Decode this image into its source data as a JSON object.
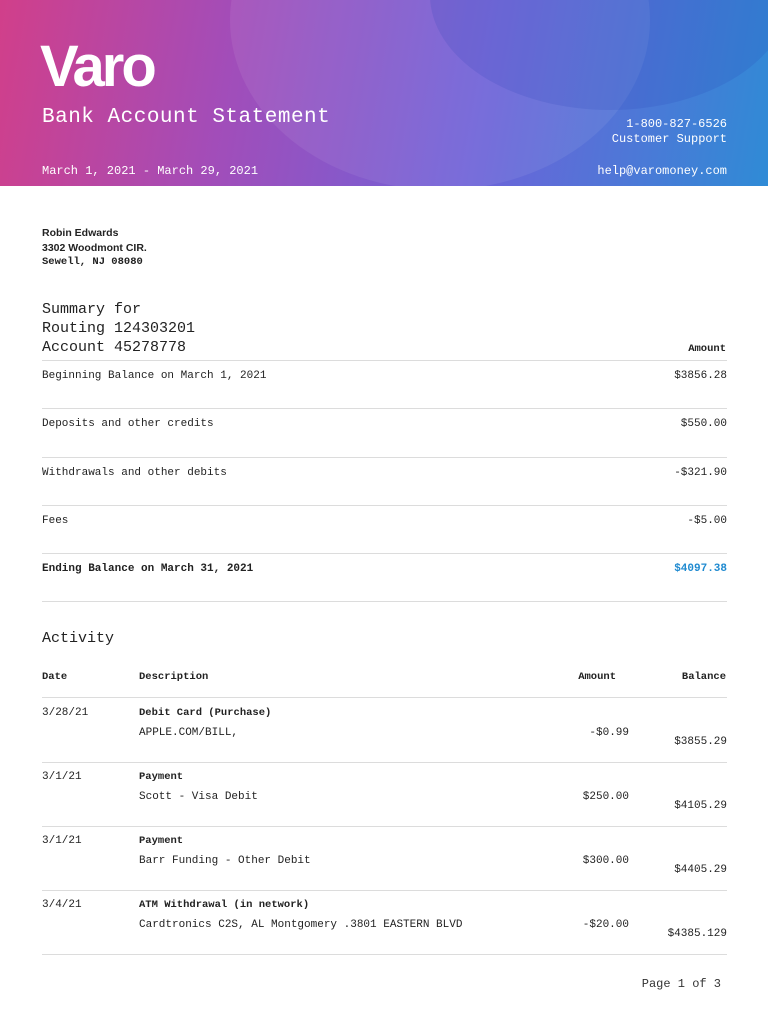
{
  "header": {
    "logo": "Varo",
    "title": "Bank Account Statement",
    "period": "March 1, 2021 - March 29, 2021",
    "phone": "1-800-827-6526",
    "support": "Customer Support",
    "email": "help@varomoney.com"
  },
  "customer": {
    "name": "Robin Edwards",
    "street": "3302 Woodmont CIR.",
    "city": "Sewell, NJ 08080"
  },
  "summary": {
    "title_line1": "Summary for",
    "routing": "Routing 124303201",
    "account": "Account 45278778",
    "amount_header": "Amount",
    "rows": [
      {
        "label": "Beginning Balance on March 1, 2021",
        "value": "$3856.28"
      },
      {
        "label": "Deposits and other credits",
        "value": "$550.00"
      },
      {
        "label": "Withdrawals and other debits",
        "value": "-$321.90"
      },
      {
        "label": "Fees",
        "value": "-$5.00"
      },
      {
        "label": "Ending Balance on March 31, 2021",
        "value": "$4097.38"
      }
    ]
  },
  "activity": {
    "title": "Activity",
    "headers": {
      "date": "Date",
      "description": "Description",
      "amount": "Amount",
      "balance": "Balance"
    },
    "rows": [
      {
        "date": "3/28/21",
        "type": "Debit Card (Purchase)",
        "description": "APPLE.COM/BILL,",
        "amount": "-$0.99",
        "balance": "$3855.29"
      },
      {
        "date": "3/1/21",
        "type": "Payment",
        "description": "Scott - Visa Debit",
        "amount": "$250.00",
        "balance": "$4105.29"
      },
      {
        "date": "3/1/21",
        "type": "Payment",
        "description": "Barr Funding - Other Debit",
        "amount": "$300.00",
        "balance": "$4405.29"
      },
      {
        "date": "3/4/21",
        "type": "ATM Withdrawal (in network)",
        "description": "Cardtronics C2S, AL Montgomery .3801 EASTERN BLVD",
        "amount": "-$20.00",
        "balance": "$4385.129"
      }
    ]
  },
  "footer": {
    "page": "Page 1 of 3"
  },
  "colors": {
    "gradient_start": "#d13f8a",
    "gradient_end": "#2f8bd6",
    "accent_total": "#1f8ad0"
  }
}
